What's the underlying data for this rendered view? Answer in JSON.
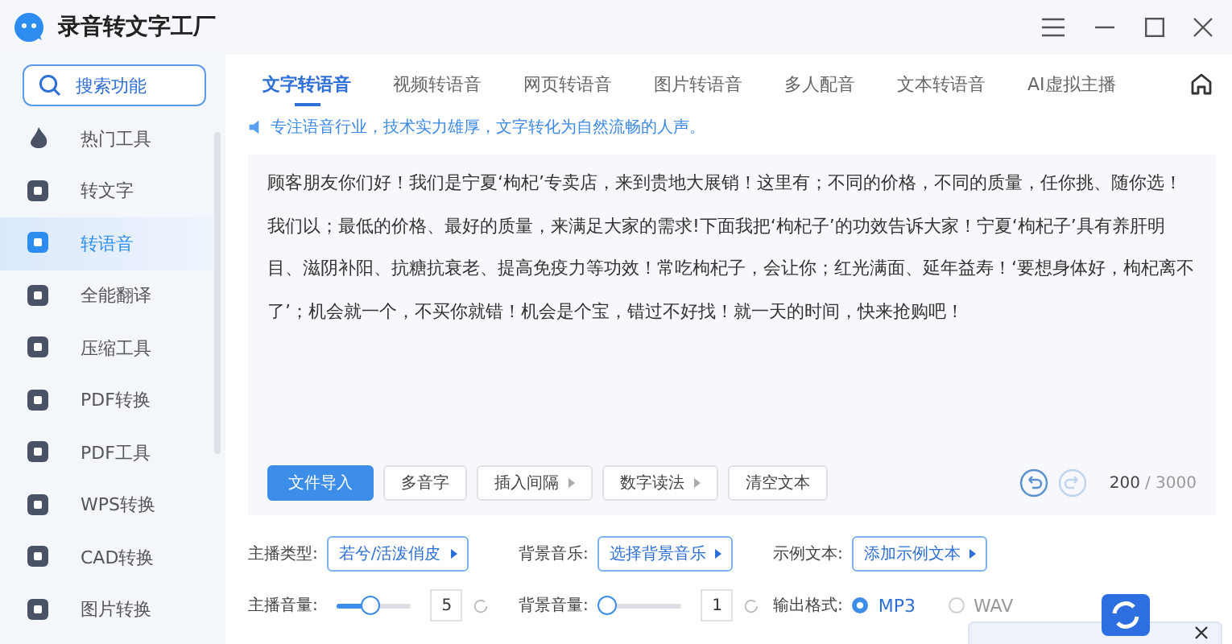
{
  "window": {
    "title": "录音转文字工厂"
  },
  "sidebar": {
    "search": {
      "placeholder": "搜索功能"
    },
    "items": [
      {
        "label": "热门工具",
        "selected": false
      },
      {
        "label": "转文字",
        "selected": false
      },
      {
        "label": "转语音",
        "selected": true
      },
      {
        "label": "全能翻译",
        "selected": false
      },
      {
        "label": "压缩工具",
        "selected": false
      },
      {
        "label": "PDF转换",
        "selected": false
      },
      {
        "label": "PDF工具",
        "selected": false
      },
      {
        "label": "WPS转换",
        "selected": false
      },
      {
        "label": "CAD转换",
        "selected": false
      },
      {
        "label": "图片转换",
        "selected": false
      }
    ]
  },
  "tabs": [
    {
      "label": "文字转语音",
      "selected": true
    },
    {
      "label": "视频转语音",
      "selected": false
    },
    {
      "label": "网页转语音",
      "selected": false
    },
    {
      "label": "图片转语音",
      "selected": false
    },
    {
      "label": "多人配音",
      "selected": false
    },
    {
      "label": "文本转语音",
      "selected": false
    },
    {
      "label": "AI虚拟主播",
      "selected": false
    }
  ],
  "hint": "专注语音行业，技术实力雄厚，文字转化为自然流畅的人声。",
  "editor": {
    "text": "顾客朋友你们好！我们是宁夏‘枸杞’专卖店，来到贵地大展销！这里有；不同的价格，不同的质量，任你挑、随你选！我们以；最低的价格、最好的质量，来满足大家的需求!下面我把‘枸杞子’的功效告诉大家！宁夏‘枸杞子’具有养肝明目、滋阴补阳、抗糖抗衰老、提高免疫力等功效！常吃枸杞子，会让你；红光满面、延年益寿！‘要想身体好，枸杞离不了’；机会就一个，不买你就错！机会是个宝，错过不好找！就一天的时间，快来抢购吧！",
    "buttons": [
      {
        "label": "文件导入",
        "kind": "primary"
      },
      {
        "label": "多音字",
        "kind": "plain"
      },
      {
        "label": "插入间隔",
        "kind": "menu"
      },
      {
        "label": "数字读法",
        "kind": "menu"
      },
      {
        "label": "清空文本",
        "kind": "plain"
      }
    ],
    "undo": {
      "disabled": false
    },
    "redo": {
      "disabled": true
    },
    "count": "200",
    "max": "/ 3000"
  },
  "settings": [
    {
      "label": "主播类型:",
      "kind": "select",
      "value": "若兮/活泼俏皮"
    },
    {
      "label": "背景音乐:",
      "kind": "select",
      "value": "选择背景音乐"
    },
    {
      "label": "示例文本:",
      "kind": "select",
      "value": "添加示例文本"
    },
    {
      "label": "主播音量:",
      "kind": "slider",
      "level": 0.45,
      "value": "5"
    },
    {
      "label": "背景音量:",
      "kind": "slider",
      "level": 0,
      "value": "1"
    },
    {
      "label": "输出格式:",
      "kind": "radio",
      "options": [
        {
          "label": "MP3",
          "selected": true
        },
        {
          "label": "WAV",
          "selected": false
        }
      ]
    }
  ]
}
